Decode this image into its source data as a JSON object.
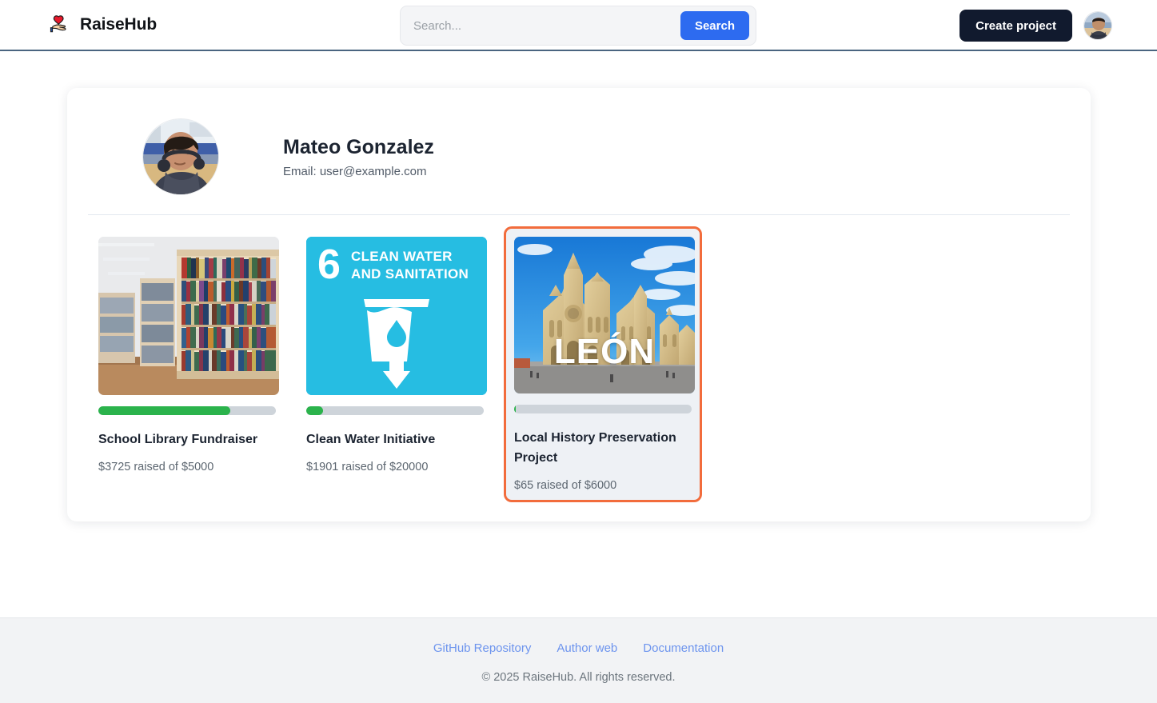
{
  "header": {
    "logo_icon": "heart-in-hand-icon",
    "brand_name": "RaiseHub",
    "search": {
      "placeholder": "Search...",
      "value": "",
      "button_label": "Search"
    },
    "create_project_label": "Create project",
    "avatar_alt": "user-avatar"
  },
  "profile": {
    "name": "Mateo Gonzalez",
    "email_label": "Email: user@example.com"
  },
  "projects": [
    {
      "id": "school-library-fundraiser",
      "title": "School Library Fundraiser",
      "funding_label": "$3725 raised of $5000",
      "raised": 3725,
      "goal": 5000,
      "percent": 74.5,
      "media": "library-bookshelves-photo",
      "selected": false
    },
    {
      "id": "clean-water-initiative",
      "title": "Clean Water Initiative",
      "funding_label": "$1901 raised of $20000",
      "raised": 1901,
      "goal": 20000,
      "percent": 9.5,
      "media": "sdg-6-clean-water-and-sanitation",
      "media_text": {
        "number": "6",
        "line1": "CLEAN WATER",
        "line2": "AND SANITATION"
      },
      "selected": false
    },
    {
      "id": "local-history-preservation-project",
      "title": "Local History Preservation Project",
      "funding_label": "$65 raised of $6000",
      "raised": 65,
      "goal": 6000,
      "percent": 1.1,
      "media": "leon-cathedral-photo",
      "media_text": {
        "overlay": "LEÓN"
      },
      "selected": true
    }
  ],
  "footer": {
    "links": [
      {
        "label": "GitHub Repository"
      },
      {
        "label": "Author web"
      },
      {
        "label": "Documentation"
      }
    ],
    "copyright": "© 2025 RaiseHub. All rights reserved."
  },
  "colors": {
    "accent_blue": "#2d6bf0",
    "dark_button": "#111a2e",
    "progress_green": "#2bb34c",
    "progress_track": "#ced4da",
    "selected_border": "#f26c3c",
    "selected_bg": "#eef1f5",
    "footer_link": "#6d94ee",
    "sdg_cyan": "#26bde2"
  }
}
